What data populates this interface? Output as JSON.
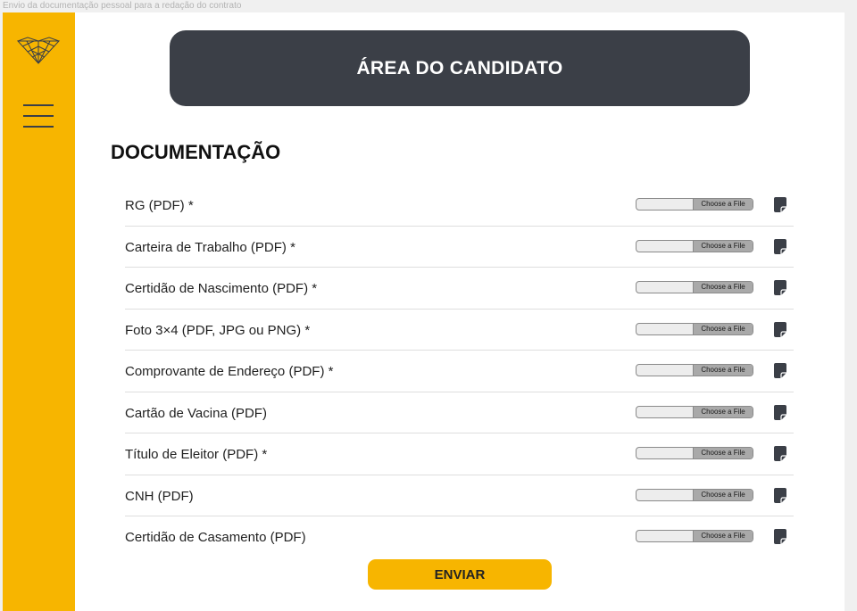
{
  "frame_label": "Envio da documentação pessoal para a redação do contrato",
  "header": {
    "title": "ÁREA DO CANDIDATO"
  },
  "section": {
    "title": "DOCUMENTAÇÃO"
  },
  "documents": [
    {
      "label": "RG (PDF) *",
      "button": "Choose a File"
    },
    {
      "label": "Carteira de Trabalho (PDF) *",
      "button": "Choose a File"
    },
    {
      "label": "Certidão de Nascimento (PDF) *",
      "button": "Choose a File"
    },
    {
      "label": "Foto 3×4 (PDF, JPG ou PNG) *",
      "button": "Choose a File"
    },
    {
      "label": "Comprovante de Endereço (PDF) *",
      "button": "Choose a File"
    },
    {
      "label": "Cartão de Vacina (PDF)",
      "button": "Choose a File"
    },
    {
      "label": "Título de Eleitor (PDF) *",
      "button": "Choose a File"
    },
    {
      "label": "CNH (PDF)",
      "button": "Choose a File"
    },
    {
      "label": "Certidão de Casamento (PDF)",
      "button": "Choose a File"
    }
  ],
  "submit_label": "ENVIAR",
  "icons": {
    "logo": "logo-icon",
    "menu": "hamburger-menu-icon",
    "document": "document-icon"
  },
  "colors": {
    "accent": "#f7b500",
    "header_bg": "#3b3f47"
  }
}
